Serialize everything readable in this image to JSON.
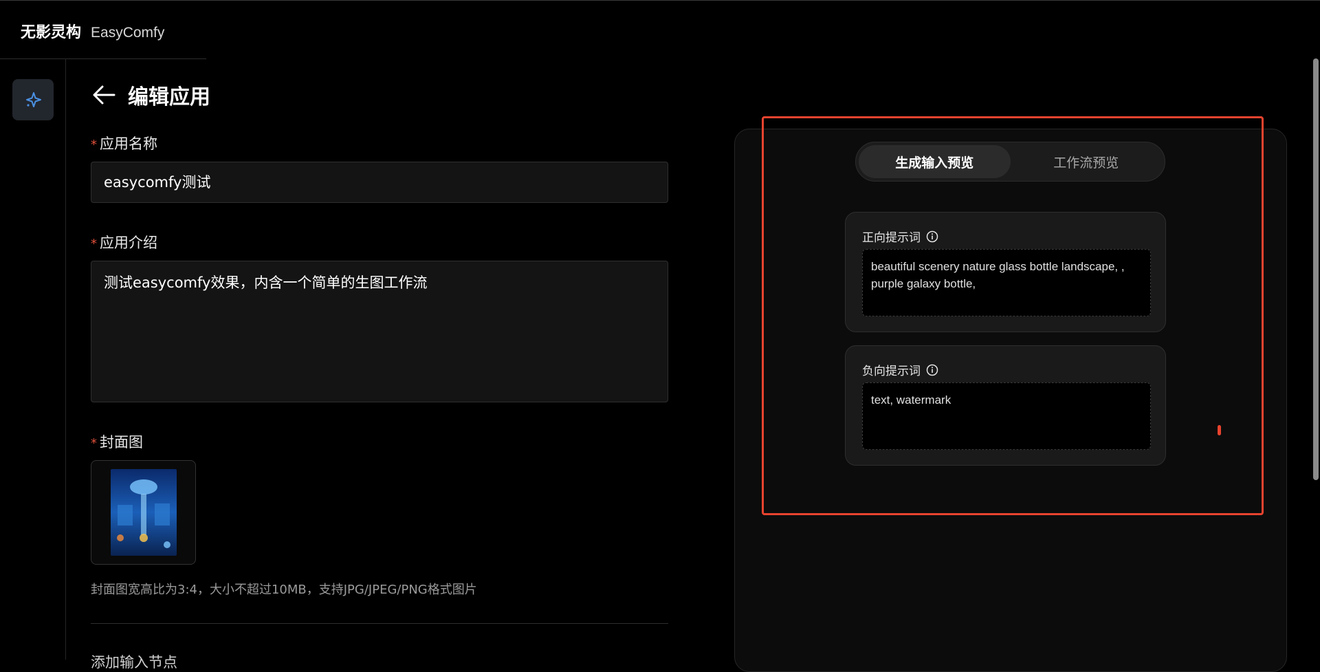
{
  "brand": {
    "name_cn": "无影灵构",
    "name_en": "EasyComfy"
  },
  "page": {
    "title": "编辑应用"
  },
  "form": {
    "required_mark": "*",
    "name_label": "应用名称",
    "name_value": "easycomfy测试",
    "desc_label": "应用介绍",
    "desc_value": "测试easycomfy效果，内含一个简单的生图工作流",
    "cover_label": "封面图",
    "cover_hint": "封面图宽高比为3:4，大小不超过10MB，支持JPG/JPEG/PNG格式图片",
    "next_section_label": "添加输入节点"
  },
  "preview": {
    "tabs": [
      {
        "label": "生成输入预览",
        "active": true
      },
      {
        "label": "工作流预览",
        "active": false
      }
    ],
    "positive_prompt": {
      "label": "正向提示词",
      "value": "beautiful scenery nature glass bottle landscape, , purple galaxy bottle,"
    },
    "negative_prompt": {
      "label": "负向提示词",
      "value": "text, watermark"
    }
  },
  "colors": {
    "accent": "#4a90e2",
    "required": "#e0503a",
    "highlight": "#e8432e"
  }
}
